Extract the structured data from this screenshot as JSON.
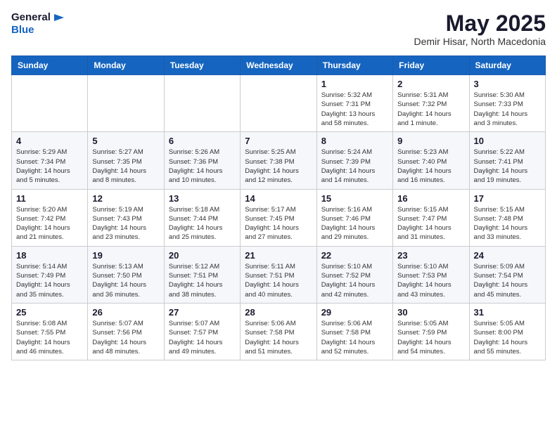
{
  "header": {
    "logo_general": "General",
    "logo_blue": "Blue",
    "month": "May 2025",
    "location": "Demir Hisar, North Macedonia"
  },
  "weekdays": [
    "Sunday",
    "Monday",
    "Tuesday",
    "Wednesday",
    "Thursday",
    "Friday",
    "Saturday"
  ],
  "weeks": [
    [
      {
        "day": "",
        "info": ""
      },
      {
        "day": "",
        "info": ""
      },
      {
        "day": "",
        "info": ""
      },
      {
        "day": "",
        "info": ""
      },
      {
        "day": "1",
        "info": "Sunrise: 5:32 AM\nSunset: 7:31 PM\nDaylight: 13 hours\nand 58 minutes."
      },
      {
        "day": "2",
        "info": "Sunrise: 5:31 AM\nSunset: 7:32 PM\nDaylight: 14 hours\nand 1 minute."
      },
      {
        "day": "3",
        "info": "Sunrise: 5:30 AM\nSunset: 7:33 PM\nDaylight: 14 hours\nand 3 minutes."
      }
    ],
    [
      {
        "day": "4",
        "info": "Sunrise: 5:29 AM\nSunset: 7:34 PM\nDaylight: 14 hours\nand 5 minutes."
      },
      {
        "day": "5",
        "info": "Sunrise: 5:27 AM\nSunset: 7:35 PM\nDaylight: 14 hours\nand 8 minutes."
      },
      {
        "day": "6",
        "info": "Sunrise: 5:26 AM\nSunset: 7:36 PM\nDaylight: 14 hours\nand 10 minutes."
      },
      {
        "day": "7",
        "info": "Sunrise: 5:25 AM\nSunset: 7:38 PM\nDaylight: 14 hours\nand 12 minutes."
      },
      {
        "day": "8",
        "info": "Sunrise: 5:24 AM\nSunset: 7:39 PM\nDaylight: 14 hours\nand 14 minutes."
      },
      {
        "day": "9",
        "info": "Sunrise: 5:23 AM\nSunset: 7:40 PM\nDaylight: 14 hours\nand 16 minutes."
      },
      {
        "day": "10",
        "info": "Sunrise: 5:22 AM\nSunset: 7:41 PM\nDaylight: 14 hours\nand 19 minutes."
      }
    ],
    [
      {
        "day": "11",
        "info": "Sunrise: 5:20 AM\nSunset: 7:42 PM\nDaylight: 14 hours\nand 21 minutes."
      },
      {
        "day": "12",
        "info": "Sunrise: 5:19 AM\nSunset: 7:43 PM\nDaylight: 14 hours\nand 23 minutes."
      },
      {
        "day": "13",
        "info": "Sunrise: 5:18 AM\nSunset: 7:44 PM\nDaylight: 14 hours\nand 25 minutes."
      },
      {
        "day": "14",
        "info": "Sunrise: 5:17 AM\nSunset: 7:45 PM\nDaylight: 14 hours\nand 27 minutes."
      },
      {
        "day": "15",
        "info": "Sunrise: 5:16 AM\nSunset: 7:46 PM\nDaylight: 14 hours\nand 29 minutes."
      },
      {
        "day": "16",
        "info": "Sunrise: 5:15 AM\nSunset: 7:47 PM\nDaylight: 14 hours\nand 31 minutes."
      },
      {
        "day": "17",
        "info": "Sunrise: 5:15 AM\nSunset: 7:48 PM\nDaylight: 14 hours\nand 33 minutes."
      }
    ],
    [
      {
        "day": "18",
        "info": "Sunrise: 5:14 AM\nSunset: 7:49 PM\nDaylight: 14 hours\nand 35 minutes."
      },
      {
        "day": "19",
        "info": "Sunrise: 5:13 AM\nSunset: 7:50 PM\nDaylight: 14 hours\nand 36 minutes."
      },
      {
        "day": "20",
        "info": "Sunrise: 5:12 AM\nSunset: 7:51 PM\nDaylight: 14 hours\nand 38 minutes."
      },
      {
        "day": "21",
        "info": "Sunrise: 5:11 AM\nSunset: 7:51 PM\nDaylight: 14 hours\nand 40 minutes."
      },
      {
        "day": "22",
        "info": "Sunrise: 5:10 AM\nSunset: 7:52 PM\nDaylight: 14 hours\nand 42 minutes."
      },
      {
        "day": "23",
        "info": "Sunrise: 5:10 AM\nSunset: 7:53 PM\nDaylight: 14 hours\nand 43 minutes."
      },
      {
        "day": "24",
        "info": "Sunrise: 5:09 AM\nSunset: 7:54 PM\nDaylight: 14 hours\nand 45 minutes."
      }
    ],
    [
      {
        "day": "25",
        "info": "Sunrise: 5:08 AM\nSunset: 7:55 PM\nDaylight: 14 hours\nand 46 minutes."
      },
      {
        "day": "26",
        "info": "Sunrise: 5:07 AM\nSunset: 7:56 PM\nDaylight: 14 hours\nand 48 minutes."
      },
      {
        "day": "27",
        "info": "Sunrise: 5:07 AM\nSunset: 7:57 PM\nDaylight: 14 hours\nand 49 minutes."
      },
      {
        "day": "28",
        "info": "Sunrise: 5:06 AM\nSunset: 7:58 PM\nDaylight: 14 hours\nand 51 minutes."
      },
      {
        "day": "29",
        "info": "Sunrise: 5:06 AM\nSunset: 7:58 PM\nDaylight: 14 hours\nand 52 minutes."
      },
      {
        "day": "30",
        "info": "Sunrise: 5:05 AM\nSunset: 7:59 PM\nDaylight: 14 hours\nand 54 minutes."
      },
      {
        "day": "31",
        "info": "Sunrise: 5:05 AM\nSunset: 8:00 PM\nDaylight: 14 hours\nand 55 minutes."
      }
    ]
  ]
}
